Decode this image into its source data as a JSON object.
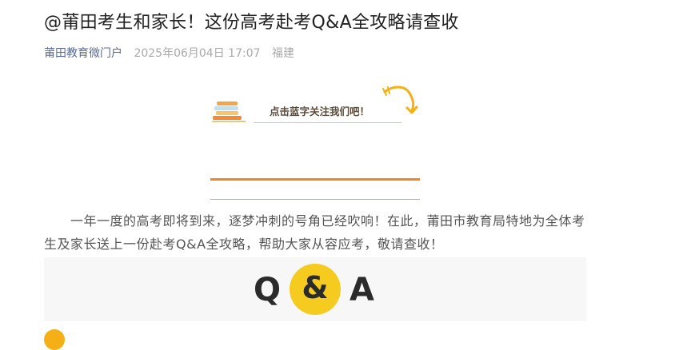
{
  "article": {
    "title": "@莆田考生和家长！这份高考赴考Q&A全攻略请查收",
    "account": "莆田教育微门户",
    "datetime": "2025年06月04日 17:07",
    "region": "福建"
  },
  "follow_banner": {
    "text": "点击蓝字关注我们吧！"
  },
  "intro": "一年一度的高考即将到来，逐梦冲刺的号角已经吹响！在此，莆田市教育局特地为全体考生及家长送上一份赴考Q&A全攻略，帮助大家从容应考，敬请查收！",
  "qa_banner": {
    "q": "Q",
    "amp": "&",
    "a": "A"
  },
  "colors": {
    "accent_orange": "#f08522",
    "qa_yellow": "#f5cb1f",
    "link_blue": "#576b95"
  }
}
